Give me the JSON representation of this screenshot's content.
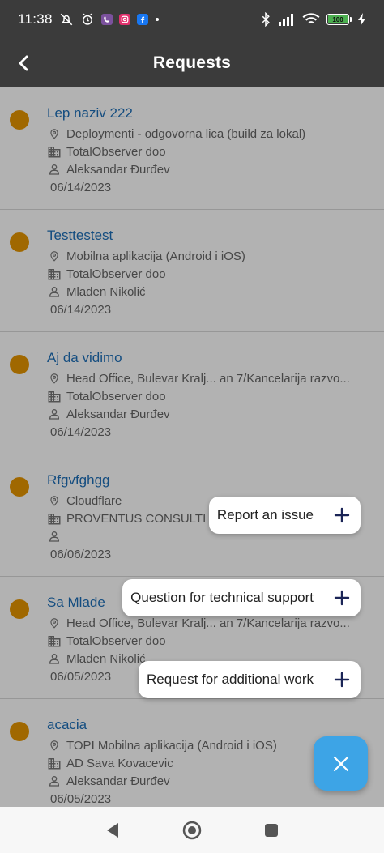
{
  "status_bar": {
    "time": "11:38",
    "battery": "100",
    "colors": {
      "viber": "#7b519d",
      "instagram": "#e1306c",
      "facebook": "#1877f2"
    }
  },
  "app_bar": {
    "title": "Requests"
  },
  "requests": [
    {
      "title": "Lep naziv 222",
      "location": "Deploymenti - odgovorna lica (build za lokal)",
      "company": "TotalObserver doo",
      "person": "Aleksandar Đurđev",
      "date": "06/14/2023"
    },
    {
      "title": "Testtestest",
      "location": "Mobilna aplikacija (Android i iOS)",
      "company": "TotalObserver doo",
      "person": "Mladen Nikolić",
      "date": "06/14/2023"
    },
    {
      "title": "Aj da vidimo",
      "location": "Head Office, Bulevar Kralj... an 7/Kancelarija razvo...",
      "company": "TotalObserver doo",
      "person": "Aleksandar Đurđev",
      "date": "06/14/2023"
    },
    {
      "title": "Rfgvfghgg",
      "location": "Cloudflare",
      "company": "PROVENTUS CONSULTI",
      "person": "",
      "date": "06/06/2023"
    },
    {
      "title": "Sa Mlade",
      "location": "Head Office, Bulevar Kralj... an 7/Kancelarija razvo...",
      "company": "TotalObserver doo",
      "person": "Mladen Nikolić",
      "date": "06/05/2023"
    },
    {
      "title": "acacia",
      "location": "TOPI Mobilna aplikacija (Android i iOS)",
      "company": "AD Sava Kovacevic",
      "person": "Aleksandar Đurđev",
      "date": "06/05/2023"
    }
  ],
  "fab_menu": {
    "report_issue": "Report an issue",
    "technical_support": "Question for technical support",
    "additional_work": "Request for additional work"
  },
  "colors": {
    "accent": "#3da4e6",
    "status_dot": "#e69500",
    "title_link": "#1e6fb8",
    "bar": "#3b3b3b"
  }
}
